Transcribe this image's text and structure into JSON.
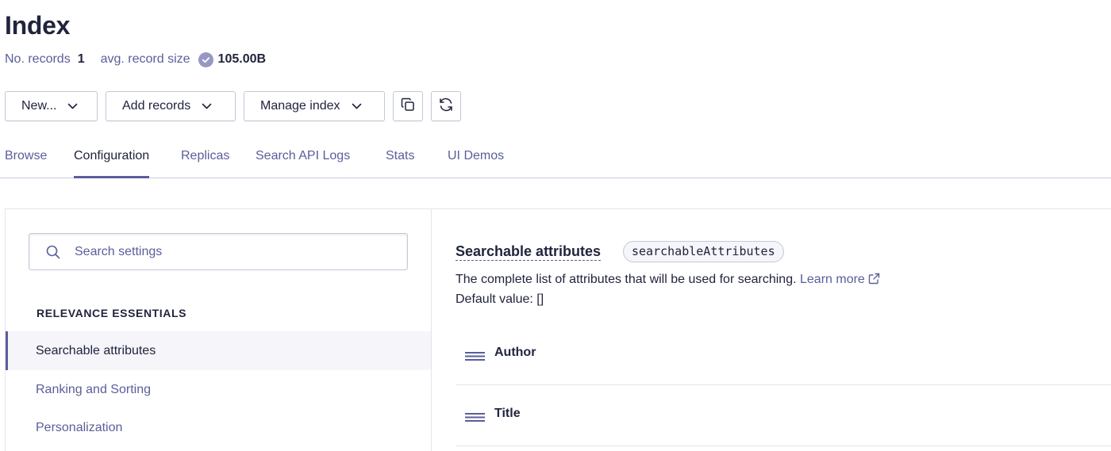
{
  "header": {
    "title": "Index",
    "records_label": "No. records",
    "records_value": "1",
    "size_label": "avg. record size",
    "size_value": "105.00B"
  },
  "toolbar": {
    "new_label": "New...",
    "add_records_label": "Add records",
    "manage_index_label": "Manage index",
    "copy_icon": "copy-icon",
    "refresh_icon": "refresh-icon"
  },
  "tabs": [
    {
      "label": "Browse",
      "active": false
    },
    {
      "label": "Configuration",
      "active": true
    },
    {
      "label": "Replicas",
      "active": false
    },
    {
      "label": "Search API Logs",
      "active": false
    },
    {
      "label": "Stats",
      "active": false
    },
    {
      "label": "UI Demos",
      "active": false
    }
  ],
  "sidebar": {
    "search_placeholder": "Search settings",
    "search_value": "",
    "section_title": "RELEVANCE ESSENTIALS",
    "items": [
      {
        "label": "Searchable attributes",
        "active": true
      },
      {
        "label": "Ranking and Sorting",
        "active": false
      },
      {
        "label": "Personalization",
        "active": false
      }
    ]
  },
  "main": {
    "title": "Searchable attributes",
    "code": "searchableAttributes",
    "description": "The complete list of attributes that will be used for searching.",
    "learn_more": "Learn more",
    "default_value": "Default value: []",
    "attributes": [
      {
        "name": "Author"
      },
      {
        "name": "Title"
      }
    ]
  },
  "colors": {
    "text_dark": "#21243d",
    "text_muted": "#5a5e9a",
    "border": "#c4c8d8",
    "active_bg": "#f5f5fa"
  }
}
